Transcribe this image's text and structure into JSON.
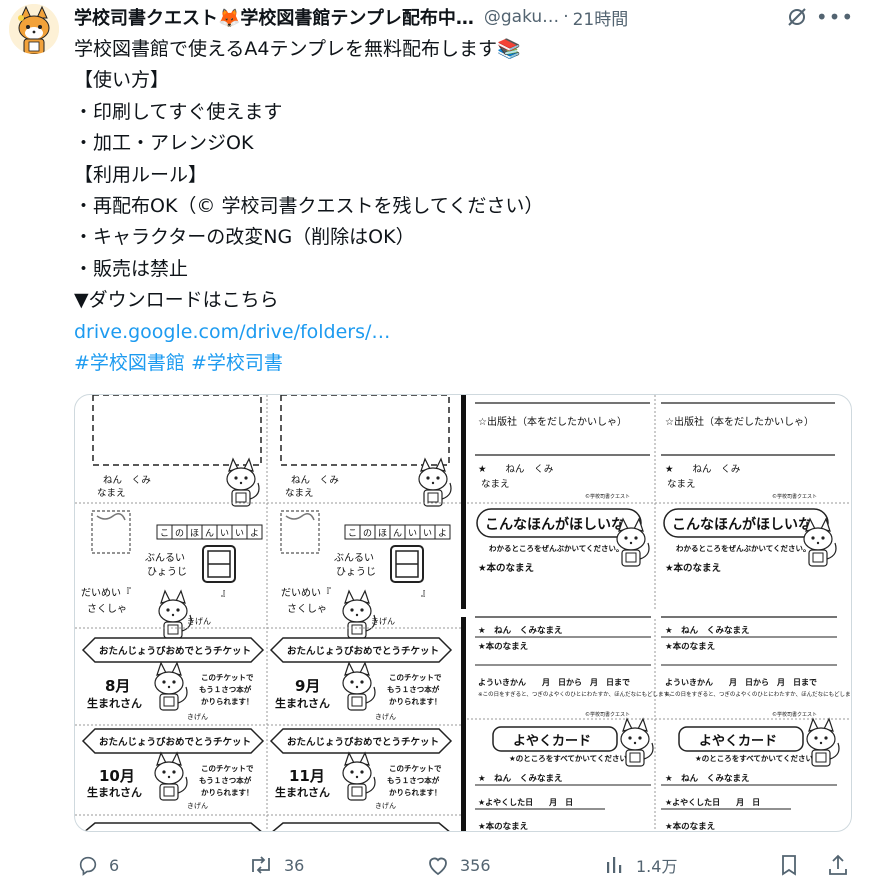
{
  "author": {
    "display_name": "学校司書クエスト🦊学校図書館テンプレ配布中…",
    "handle": "@gaku…",
    "time": "21時間",
    "avatar_icon": "fox-mascot-avatar"
  },
  "tweet": {
    "lines": [
      "学校図書館で使えるA4テンプレを無料配布します📚",
      "【使い方】",
      "・印刷してすぐ使えます",
      "・加工・アレンジOK",
      "【利用ルール】",
      "・再配布OK（© 学校司書クエストを残してください）",
      "・キャラクターの改変NG（削除はOK）",
      "・販売は禁止",
      "▼ダウンロードはこちら"
    ],
    "link": "drive.google.com/drive/folders/…",
    "hashtags": [
      "#学校図書館",
      "#学校司書"
    ]
  },
  "media": {
    "left_sheet": {
      "name_label_top": "ねん　くみ",
      "name_label_bottom": "なまえ",
      "hiragana_boxes": [
        "こ",
        "の",
        "ほ",
        "ん",
        "い",
        "い",
        "よ"
      ],
      "bunrui": "ぶんるい",
      "hyouji": "ひょうじ",
      "title_label": "だいめい『　　　　　　　　　』",
      "author_label": "さくしゃ",
      "kigen": "きげん",
      "ticket_header": "おたんじょうびおめでとうチケット",
      "ticket_body": [
        "このチケットで",
        "もう１さつ本が",
        "かりられます！"
      ],
      "months": [
        "8月",
        "9月",
        "10月",
        "11月"
      ],
      "born": "生まれさん"
    },
    "right_sheet": {
      "publisher": "☆出版社（本をだしたかいしゃ）",
      "grade_class": "★　　ねん　くみ",
      "name": "なまえ",
      "wish_title": "こんなほんがほしいな",
      "wish_sub": "わかるところをぜんぶかいてください。",
      "book_name": "★本のなまえ",
      "name_row": "★　ねん　くみなまえ",
      "period": "よういきかん　　月　日から　月　日まで",
      "note1": "※この日をすぎると、つぎのよやくのひとにわたすか、ほんだなにもどします。",
      "reserve_title": "よやくカード",
      "reserve_sub": "★のところをすべてかいてください。",
      "reserve_date": "★よやくした日　　月　日",
      "credit": "©学校司書クエスト"
    }
  },
  "actions": {
    "replies": "6",
    "reposts": "36",
    "likes": "356",
    "views": "1.4万"
  }
}
